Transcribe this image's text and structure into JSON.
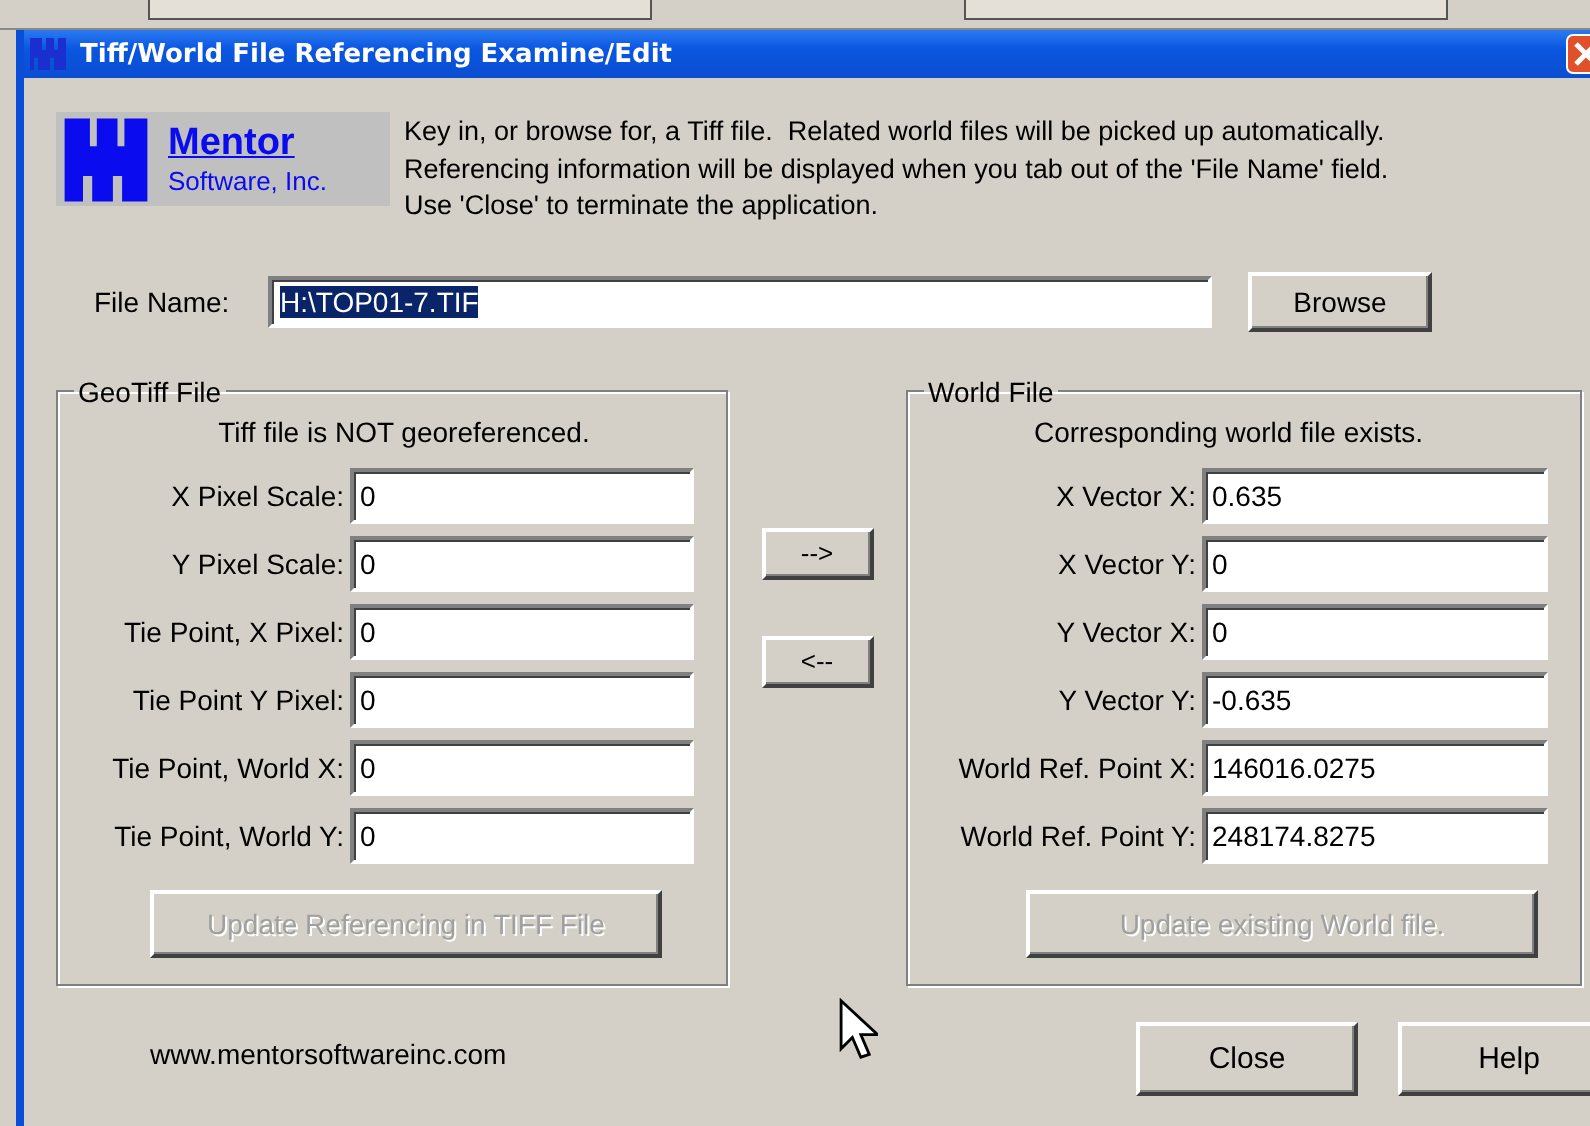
{
  "window": {
    "title": "Tiff/World File Referencing Examine/Edit"
  },
  "logo": {
    "name": "Mentor",
    "subtitle": "Software, Inc."
  },
  "description": [
    "Key in, or browse for, a Tiff file.  Related world files will be picked up automatically.",
    "Referencing information will be displayed when you tab out of the 'File Name' field.",
    "Use 'Close' to terminate the application."
  ],
  "file_name": {
    "label": "File Name:",
    "value": "H:\\TOP01-7.TIF",
    "selected": true
  },
  "browse_button": {
    "label": "Browse",
    "disabled": false
  },
  "geotiff": {
    "title": "GeoTiff File",
    "status": "Tiff file is NOT georeferenced.",
    "fields": [
      {
        "label": "X Pixel Scale:",
        "value": "0"
      },
      {
        "label": "Y Pixel Scale:",
        "value": "0"
      },
      {
        "label": "Tie Point, X Pixel:",
        "value": "0"
      },
      {
        "label": "Tie Point Y Pixel:",
        "value": "0"
      },
      {
        "label": "Tie Point, World X:",
        "value": "0"
      },
      {
        "label": "Tie Point, World Y:",
        "value": "0"
      }
    ],
    "update_button": {
      "label": "Update Referencing in TIFF File",
      "disabled": true
    }
  },
  "transfer_buttons": [
    {
      "label": "-->",
      "disabled": false
    },
    {
      "label": "<--",
      "disabled": false
    }
  ],
  "world": {
    "title": "World File",
    "status": "Corresponding world file exists.",
    "fields": [
      {
        "label": "X Vector X:",
        "value": "0.635"
      },
      {
        "label": "X Vector Y:",
        "value": "0"
      },
      {
        "label": "Y Vector X:",
        "value": "0"
      },
      {
        "label": "Y Vector Y:",
        "value": "-0.635"
      },
      {
        "label": "World Ref. Point X:",
        "value": "146016.0275"
      },
      {
        "label": "World Ref. Point Y:",
        "value": "248174.8275"
      }
    ],
    "update_button": {
      "label": "Update existing World file.",
      "disabled": true
    }
  },
  "footer": {
    "url": "www.mentorsoftwareinc.com",
    "buttons": [
      {
        "label": "Close",
        "disabled": false
      },
      {
        "label": "Help",
        "disabled": false
      }
    ]
  }
}
